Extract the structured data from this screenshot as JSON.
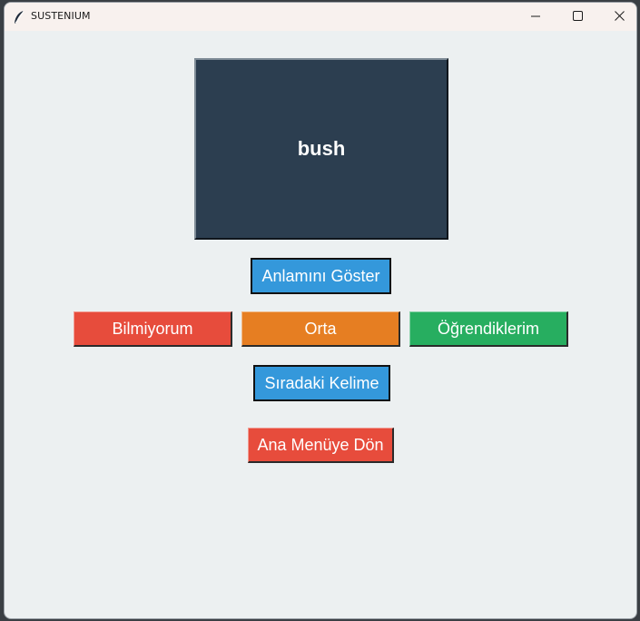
{
  "window": {
    "title": "SUSTENIUM",
    "app_icon": "feather-icon",
    "controls": {
      "minimize_icon": "minimize-icon",
      "maximize_icon": "maximize-icon",
      "close_icon": "close-icon"
    }
  },
  "card": {
    "word": "bush"
  },
  "buttons": {
    "show_meaning": "Anlamını Göster",
    "dont_know": "Bilmiyorum",
    "medium": "Orta",
    "learned": "Öğrendiklerim",
    "next_word": "Sıradaki Kelime",
    "main_menu": "Ana Menüye Dön"
  },
  "colors": {
    "card_bg": "#2c3e50",
    "window_bg": "#ecf0f1",
    "blue": "#3498db",
    "red": "#e74c3c",
    "orange": "#e67e22",
    "green": "#27ae60"
  }
}
